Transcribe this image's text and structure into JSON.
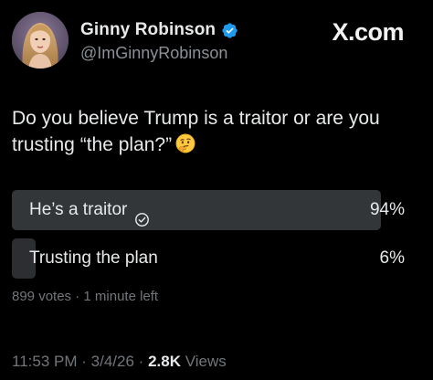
{
  "author": {
    "display_name": "Ginny Robinson",
    "handle": "@ImGinnyRobinson",
    "verified": true,
    "avatar_icon": "avatar-photo"
  },
  "brand": "X.com",
  "tweet": {
    "text": "Do you believe Trump is a traitor or are you trusting “the plan?”",
    "emoji": "thinking-face-emoji"
  },
  "poll": {
    "options": [
      {
        "label": "He’s a traitor",
        "percent_label": "94%",
        "percent": 94,
        "selected": true
      },
      {
        "label": "Trusting the plan",
        "percent_label": "6%",
        "percent": 6,
        "selected": false
      }
    ],
    "votes": "899 votes",
    "separator": "·",
    "time_left": "1 minute left"
  },
  "footer": {
    "time": "11:53 PM",
    "date": "3/4/26",
    "separator": "·",
    "views_count": "2.8K",
    "views_label": "Views"
  },
  "colors": {
    "background": "#000000",
    "text_primary": "#e7e9ea",
    "text_secondary": "#71767b",
    "verified_blue": "#1d9bf0",
    "poll_bar": "#333639"
  }
}
